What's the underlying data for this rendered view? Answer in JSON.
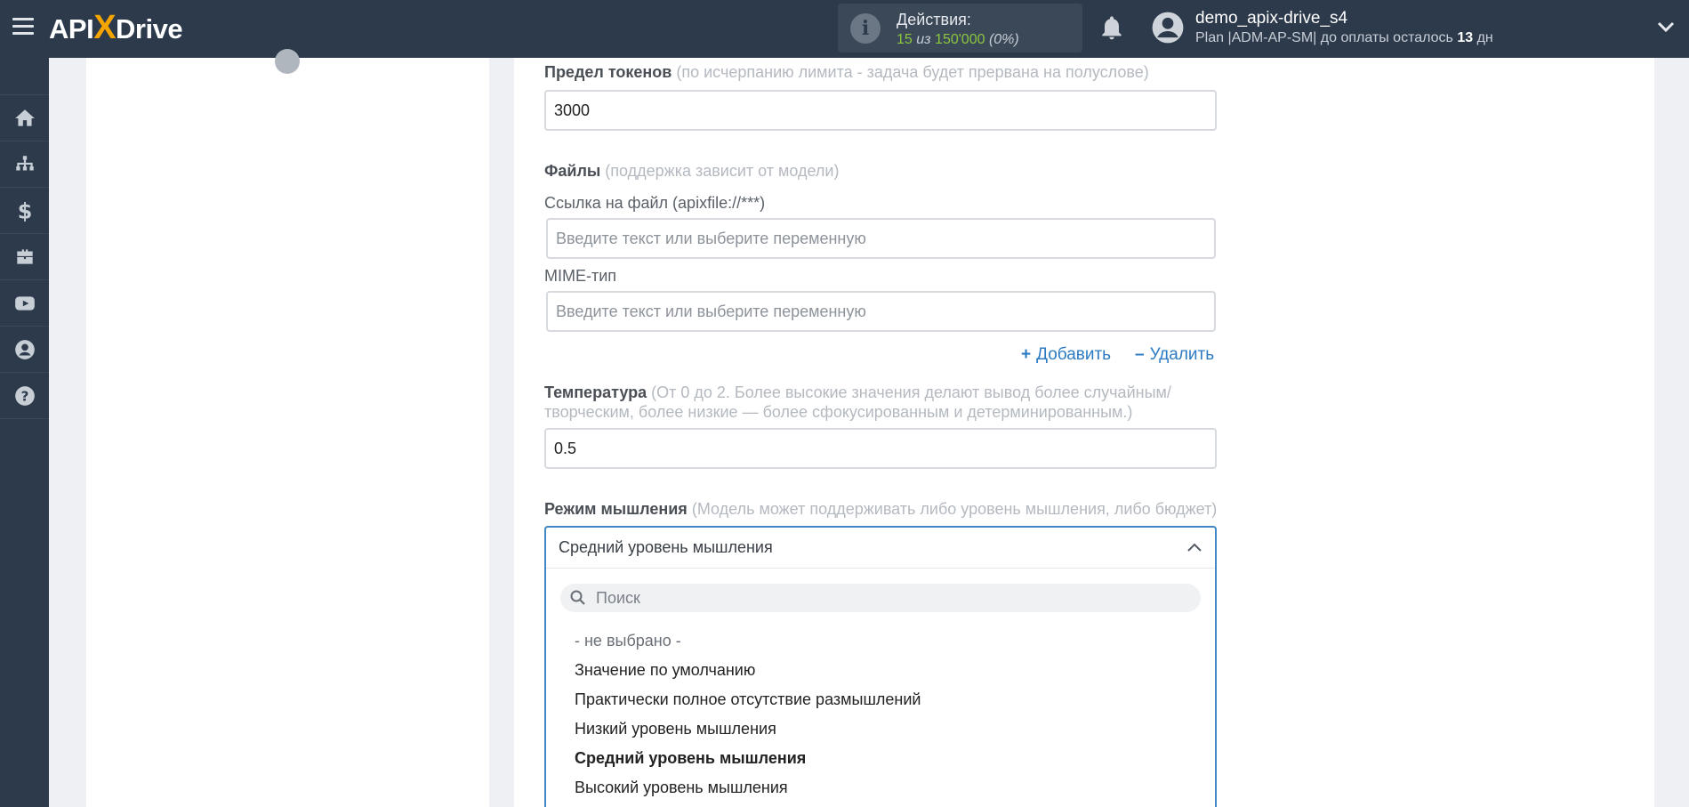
{
  "header": {
    "logo_left": "API",
    "logo_x": "X",
    "logo_right": "Drive",
    "actions_label": "Действия:",
    "actions_used": "15",
    "actions_of": "из",
    "actions_total": "150'000",
    "actions_percent": "(0%)",
    "user_name": "demo_apix-drive_s4",
    "plan_text": "Plan |ADM-AP-SM| до оплаты осталось",
    "plan_days": "13",
    "plan_days_unit": "дн"
  },
  "sidebar": {
    "items": [
      "home-icon",
      "sitemap-icon",
      "dollar-icon",
      "briefcase-icon",
      "youtube-icon",
      "user-icon",
      "help-icon"
    ]
  },
  "form": {
    "tokens": {
      "label": "Предел токенов",
      "hint": "(по исчерпанию лимита - задача будет прервана на полуслове)",
      "value": "3000"
    },
    "files": {
      "label": "Файлы",
      "hint": "(поддержка зависит от модели)",
      "link_label": "Ссылка на файл (apixfile://***)",
      "link_placeholder": "Введите текст или выберите переменную",
      "mime_label": "MIME-тип",
      "mime_placeholder": "Введите текст или выберите переменную",
      "add_label": "Добавить",
      "remove_label": "Удалить"
    },
    "temperature": {
      "label": "Температура",
      "hint": "(От 0 до 2. Более высокие значения делают вывод более случайным/ творческим, более низкие — более сфокусированным и детерминированным.)",
      "value": "0.5"
    },
    "thinking": {
      "label": "Режим мышления",
      "hint": "(Модель может поддерживать либо уровень мышления, либо бюджет)",
      "selected": "Средний уровень мышления",
      "search_placeholder": "Поиск",
      "options": [
        "- не выбрано -",
        "Значение по умолчанию",
        "Практически полное отсутствие размышлений",
        "Низкий уровень мышления",
        "Средний уровень мышления",
        "Высокий уровень мышления"
      ]
    }
  }
}
